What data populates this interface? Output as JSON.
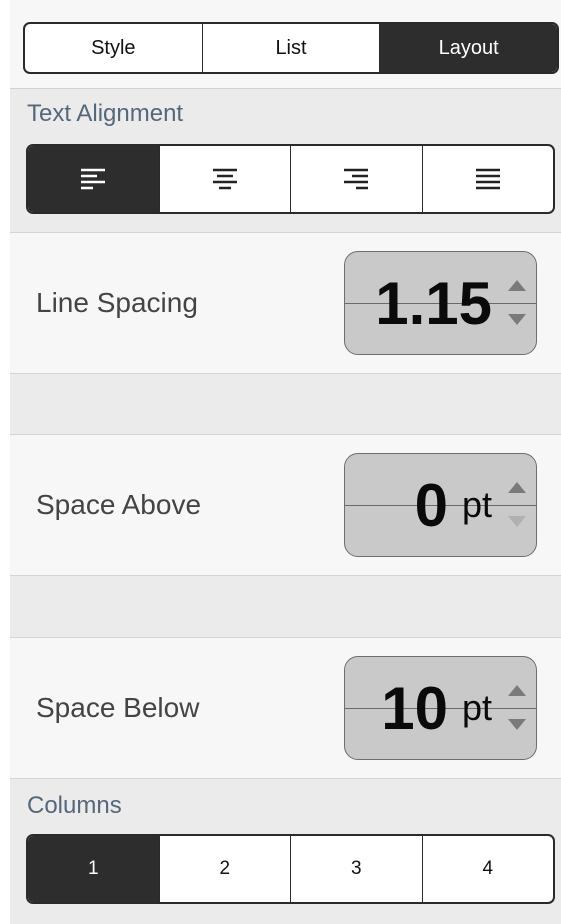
{
  "tabs": [
    {
      "label": "Style",
      "selected": false
    },
    {
      "label": "List",
      "selected": false
    },
    {
      "label": "Layout",
      "selected": true
    }
  ],
  "text_alignment": {
    "label": "Text Alignment",
    "options": [
      {
        "icon": "align-left-icon",
        "selected": true
      },
      {
        "icon": "align-center-icon",
        "selected": false
      },
      {
        "icon": "align-right-icon",
        "selected": false
      },
      {
        "icon": "align-justify-icon",
        "selected": false
      }
    ]
  },
  "line_spacing": {
    "label": "Line Spacing",
    "value": "1.15",
    "unit": ""
  },
  "space_above": {
    "label": "Space Above",
    "value": "0",
    "unit": "pt"
  },
  "space_below": {
    "label": "Space Below",
    "value": "10",
    "unit": "pt"
  },
  "columns": {
    "label": "Columns",
    "options": [
      {
        "label": "1",
        "selected": true
      },
      {
        "label": "2",
        "selected": false
      },
      {
        "label": "3",
        "selected": false
      },
      {
        "label": "4",
        "selected": false
      }
    ]
  },
  "colors": {
    "selected_segment": "#2d2d2d",
    "section_label": "#55677a",
    "stepper_fill": "#c9c9c9"
  }
}
